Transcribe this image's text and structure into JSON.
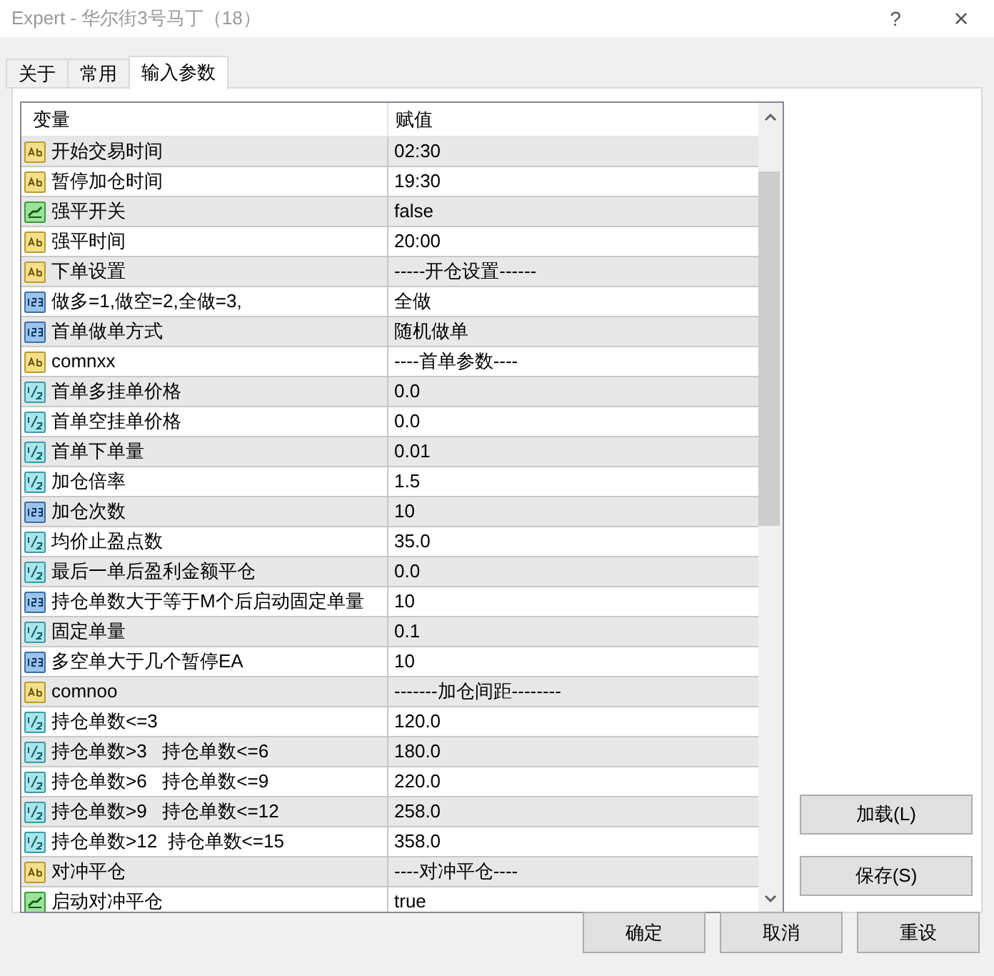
{
  "window": {
    "title": "Expert - 华尔街3号马丁（18）",
    "help": "?",
    "close": "×"
  },
  "tabs": [
    {
      "label": "关于",
      "selected": false
    },
    {
      "label": "常用",
      "selected": false
    },
    {
      "label": "输入参数",
      "selected": true
    }
  ],
  "table": {
    "columns": [
      "变量",
      "赋值"
    ],
    "rows": [
      {
        "kind": "string",
        "name": "开始交易时间",
        "value": "02:30"
      },
      {
        "kind": "string",
        "name": "暂停加仓时间",
        "value": "19:30"
      },
      {
        "kind": "bool",
        "name": "强平开关",
        "value": "false"
      },
      {
        "kind": "string",
        "name": "强平时间",
        "value": "20:00"
      },
      {
        "kind": "string",
        "name": "下单设置",
        "value": "-----开仓设置------"
      },
      {
        "kind": "int",
        "name": "做多=1,做空=2,全做=3,",
        "value": "全做"
      },
      {
        "kind": "int",
        "name": "首单做单方式",
        "value": "随机做单"
      },
      {
        "kind": "string",
        "name": "comnxx",
        "value": "----首单参数----"
      },
      {
        "kind": "double",
        "name": "首单多挂单价格",
        "value": "0.0"
      },
      {
        "kind": "double",
        "name": "首单空挂单价格",
        "value": "0.0"
      },
      {
        "kind": "double",
        "name": "首单下单量",
        "value": "0.01"
      },
      {
        "kind": "double",
        "name": "加仓倍率",
        "value": "1.5"
      },
      {
        "kind": "int",
        "name": "加仓次数",
        "value": "10"
      },
      {
        "kind": "double",
        "name": "均价止盈点数",
        "value": "35.0"
      },
      {
        "kind": "double",
        "name": "最后一单后盈利金额平仓",
        "value": "0.0"
      },
      {
        "kind": "int",
        "name": "持仓单数大于等于M个后启动固定单量",
        "value": "10"
      },
      {
        "kind": "double",
        "name": "固定单量",
        "value": "0.1"
      },
      {
        "kind": "int",
        "name": "多空单大于几个暂停EA",
        "value": "10"
      },
      {
        "kind": "string",
        "name": "comnoo",
        "value": "-------加仓间距--------"
      },
      {
        "kind": "double",
        "name": "持仓单数<=3",
        "value": "120.0"
      },
      {
        "kind": "double",
        "name": "持仓单数>3   持仓单数<=6",
        "value": "180.0"
      },
      {
        "kind": "double",
        "name": "持仓单数>6   持仓单数<=9",
        "value": "220.0"
      },
      {
        "kind": "double",
        "name": "持仓单数>9   持仓单数<=12",
        "value": "258.0"
      },
      {
        "kind": "double",
        "name": "持仓单数>12  持仓单数<=15",
        "value": "358.0"
      },
      {
        "kind": "string",
        "name": "对冲平仓",
        "value": "----对冲平仓----"
      },
      {
        "kind": "bool",
        "name": "启动对冲平仓",
        "value": "true"
      }
    ]
  },
  "side_buttons": [
    "加载(L)",
    "保存(S)"
  ],
  "buttons": [
    "确定",
    "取消",
    "重设"
  ]
}
